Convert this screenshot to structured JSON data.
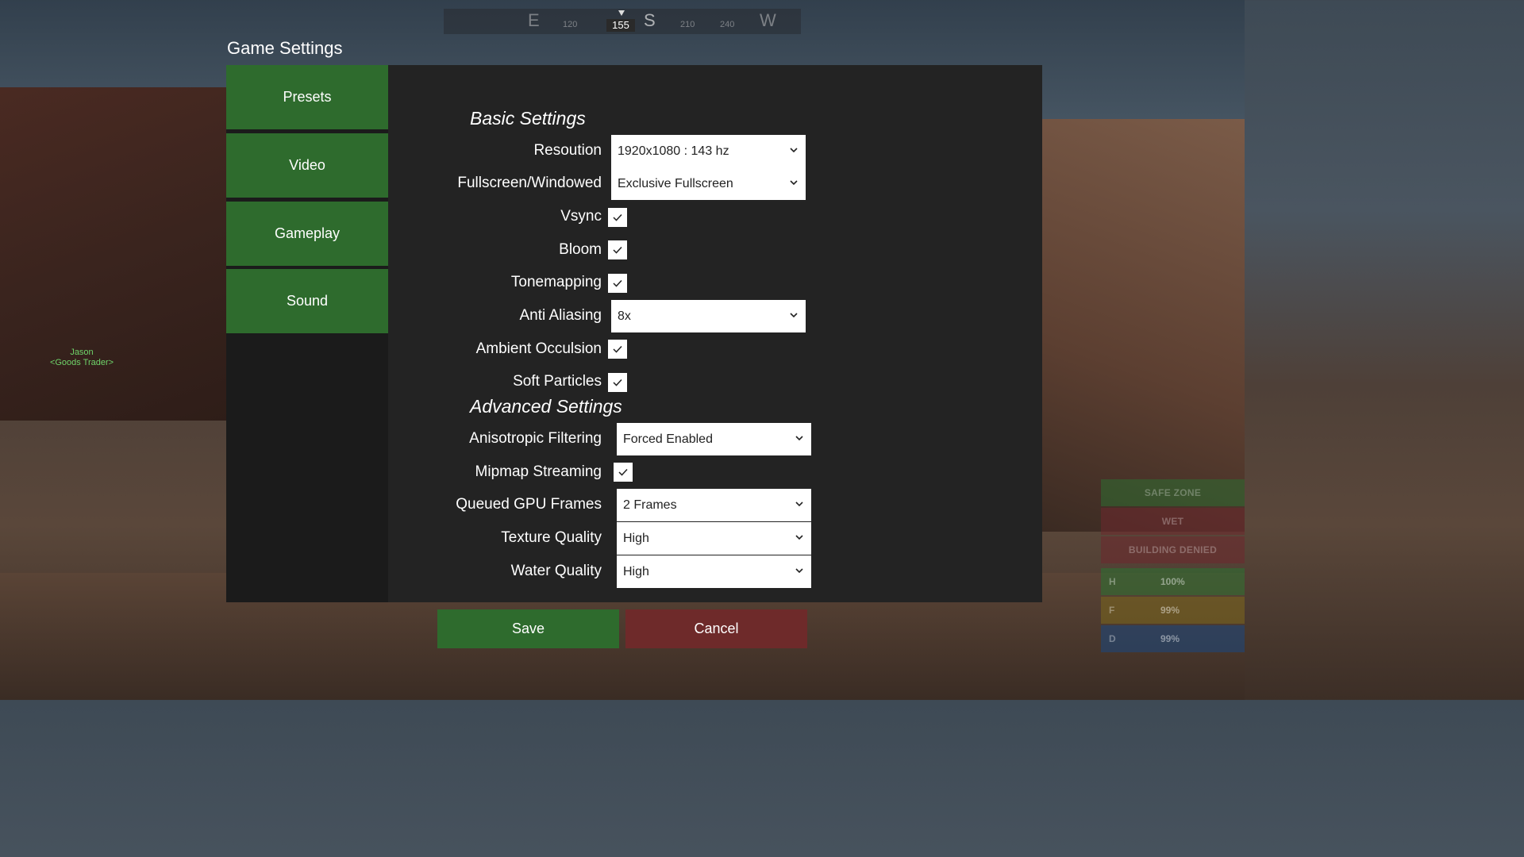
{
  "compass": {
    "ticks": [
      "E",
      "120",
      "S",
      "210",
      "240",
      "W"
    ],
    "current": "155"
  },
  "world": {
    "npc_name": "Jason",
    "npc_role": "<Goods Trader>"
  },
  "title": "Game Settings",
  "nav": {
    "presets": "Presets",
    "video": "Video",
    "gameplay": "Gameplay",
    "sound": "Sound"
  },
  "basic": {
    "heading": "Basic Settings",
    "resolution_label": "Resoution",
    "resolution_value": "1920x1080 : 143 hz",
    "fullscreen_label": "Fullscreen/Windowed",
    "fullscreen_value": "Exclusive Fullscreen",
    "vsync_label": "Vsync",
    "vsync_checked": true,
    "bloom_label": "Bloom",
    "bloom_checked": true,
    "tonemapping_label": "Tonemapping",
    "tonemapping_checked": true,
    "aa_label": "Anti Aliasing",
    "aa_value": "8x",
    "ao_label": "Ambient Occulsion",
    "ao_checked": true,
    "soft_particles_label": "Soft Particles",
    "soft_particles_checked": true
  },
  "advanced": {
    "heading": "Advanced Settings",
    "aniso_label": "Anisotropic Filtering",
    "aniso_value": "Forced Enabled",
    "mipmap_label": "Mipmap Streaming",
    "mipmap_checked": true,
    "gpu_frames_label": "Queued GPU Frames",
    "gpu_frames_value": "2 Frames",
    "texture_label": "Texture Quality",
    "texture_value": "High",
    "water_label": "Water Quality",
    "water_value": "High"
  },
  "buttons": {
    "save": "Save",
    "cancel": "Cancel"
  },
  "hud": {
    "safe_zone": "SAFE ZONE",
    "wet": "WET",
    "building_denied": "BUILDING DENIED",
    "health_key": "H",
    "health_value": "100%",
    "food_key": "F",
    "food_value": "99%",
    "drink_key": "D",
    "drink_value": "99%"
  },
  "colors": {
    "green": "#2e6b2d",
    "red": "#6e2a2a",
    "panel": "#232323",
    "sidebar": "#1b1b1b"
  }
}
